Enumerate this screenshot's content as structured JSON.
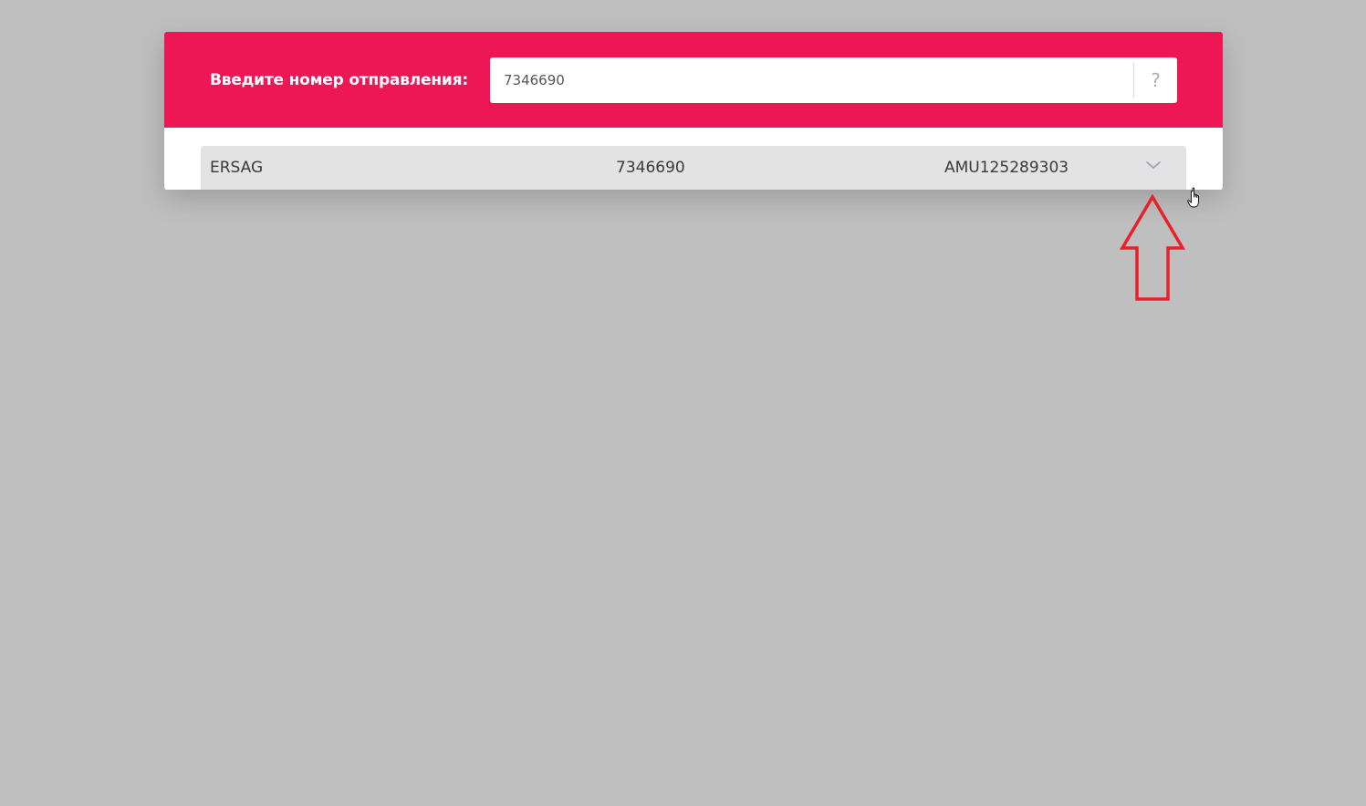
{
  "tracking_form": {
    "label": "Введите номер отправления:",
    "input_value": "7346690",
    "help_label": "?"
  },
  "results": [
    {
      "company": "ERSAG",
      "number": "7346690",
      "tracking_code": "AMU125289303",
      "expand_icon": "chevron-down-icon"
    }
  ],
  "colors": {
    "header_bg": "#ee1755",
    "page_bg": "#bfbfbf",
    "row_bg": "#e3e3e3",
    "annotation": "#e8202a"
  }
}
